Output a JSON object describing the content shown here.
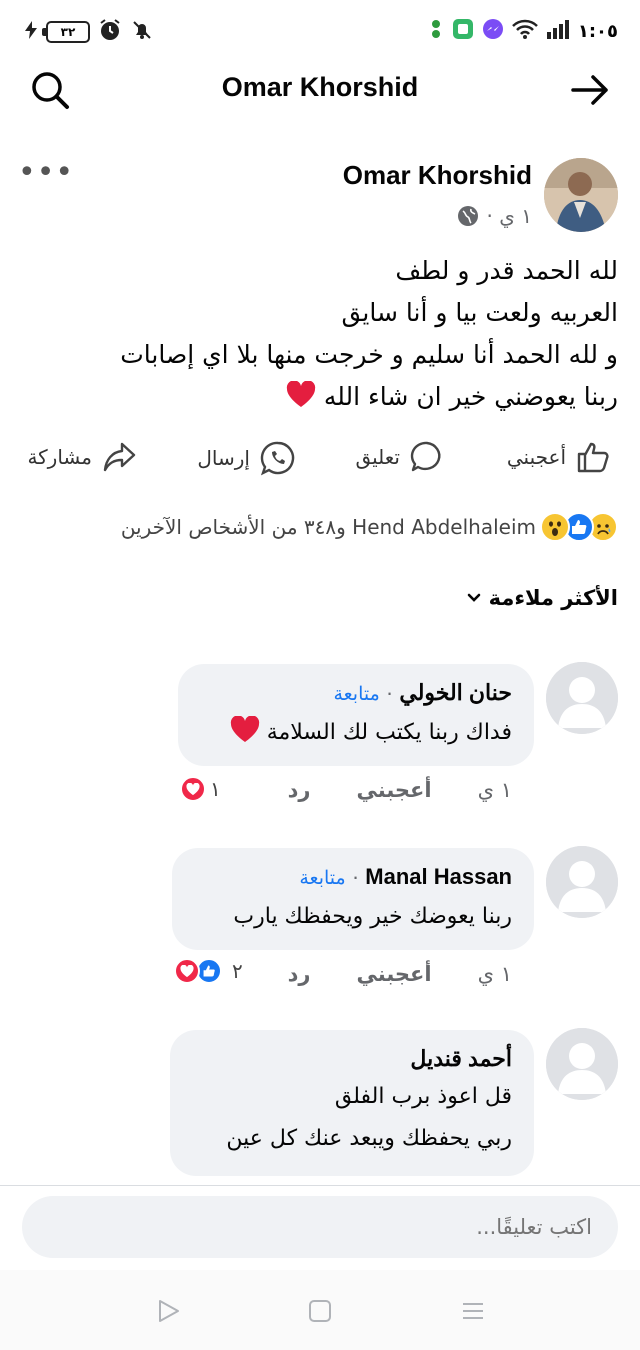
{
  "status_bar": {
    "time": "١:٠٥",
    "battery": "٣٢"
  },
  "header": {
    "title": "Omar Khorshid"
  },
  "post": {
    "author": "Omar Khorshid",
    "time": "١ ي ·",
    "lines": [
      "لله الحمد قدر و لطف",
      "العربيه ولعت بيا و أنا سايق",
      "و لله الحمد أنا سليم و خرجت منها بلا اي إصابات",
      "ربنا يعوضني خير ان شاء الله"
    ]
  },
  "actions": {
    "like": "أعجبني",
    "comment": "تعليق",
    "send": "إرسال",
    "share": "مشاركة"
  },
  "reactions": {
    "summary": "Hend Abdelhaleim و٣٤٨ من الأشخاص الآخرين"
  },
  "sort": {
    "label": "الأكثر ملاءمة"
  },
  "comments": [
    {
      "name": "حنان الخولي",
      "follow": "متابعة",
      "text": "فداك ربنا يكتب لك السلامة",
      "time": "١ ي",
      "like": "أعجبني",
      "reply": "رد",
      "reaction_count": "١"
    },
    {
      "name": "Manal Hassan",
      "follow": "متابعة",
      "text": "ربنا يعوضك خير ويحفظك يارب",
      "time": "١ ي",
      "like": "أعجبني",
      "reply": "رد",
      "reaction_count": "٢"
    },
    {
      "name": "أحمد قنديل",
      "text_lines": [
        "قل اعوذ برب الفلق",
        "ربي يحفظك ويبعد عنك كل عين"
      ]
    }
  ],
  "composer": {
    "placeholder": "اكتب تعليقًا..."
  },
  "colors": {
    "accent": "#1877f2",
    "love": "#f02849",
    "bubble": "#f0f2f5",
    "muted": "#65676b"
  }
}
